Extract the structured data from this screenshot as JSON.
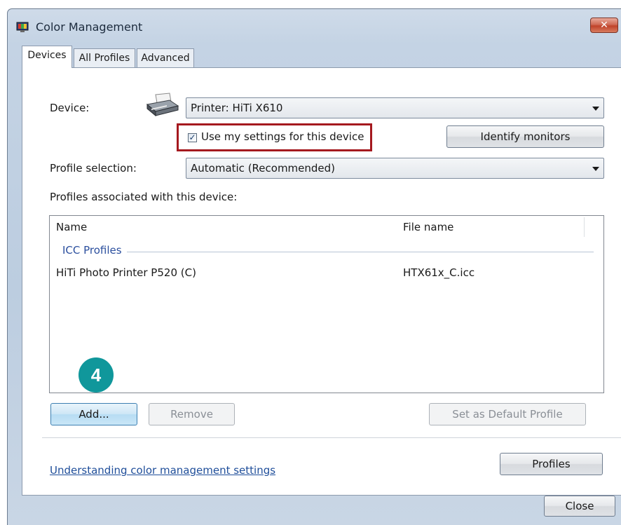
{
  "window": {
    "title": "Color Management",
    "close_glyph": "✕"
  },
  "tabs": [
    {
      "label": "Devices",
      "active": true
    },
    {
      "label": "All Profiles",
      "active": false
    },
    {
      "label": "Advanced",
      "active": false
    }
  ],
  "device": {
    "label": "Device:",
    "icon": "printer-icon",
    "selected": "Printer: HiTi X610"
  },
  "use_settings": {
    "label": "Use my settings for this device",
    "checked": true
  },
  "identify_button": "Identify monitors",
  "profile_selection": {
    "label": "Profile selection:",
    "selected": "Automatic (Recommended)"
  },
  "profiles_caption": "Profiles associated with this device:",
  "table": {
    "columns": [
      "Name",
      "File name"
    ],
    "group": "ICC Profiles",
    "rows": [
      {
        "name": "HiTi Photo Printer P520 (C)",
        "file": "HTX61x_C.icc"
      }
    ]
  },
  "step_badge": "4",
  "buttons": {
    "add": "Add...",
    "remove": "Remove",
    "set_default": "Set as Default Profile",
    "profiles": "Profiles",
    "close": "Close"
  },
  "link": "Understanding color management settings",
  "colors": {
    "highlight": "#a5191f",
    "badge": "#10979b",
    "link": "#1f4e9a"
  }
}
